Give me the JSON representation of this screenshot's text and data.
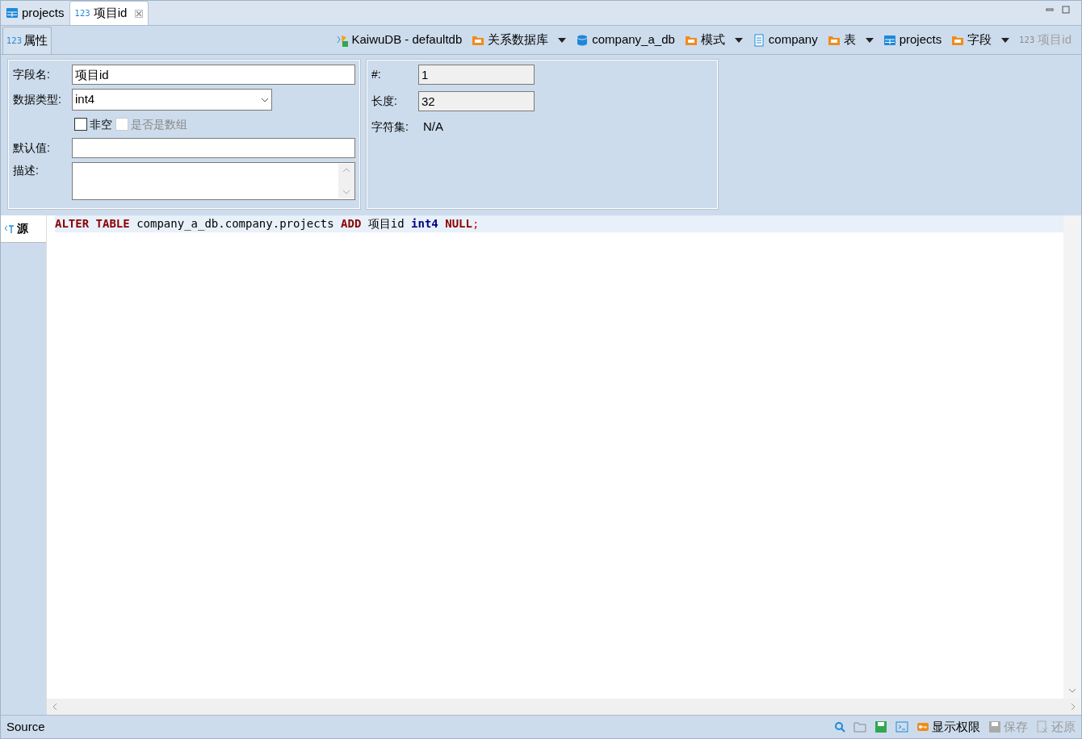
{
  "editor_tabs": [
    {
      "label": "projects",
      "kind": "table",
      "selected": false,
      "closable": false
    },
    {
      "label": "项目id",
      "kind": "column",
      "icon_text": "123",
      "selected": true,
      "closable": true
    }
  ],
  "section_tab": {
    "label": "属性",
    "icon_text": "123",
    "selected": true
  },
  "breadcrumb": [
    {
      "label": "KaiwuDB - defaultdb",
      "kind": "connection",
      "has_menu": false,
      "disabled": false
    },
    {
      "label": "关系数据库",
      "kind": "folder",
      "has_menu": true,
      "disabled": false
    },
    {
      "label": "company_a_db",
      "kind": "database",
      "has_menu": false,
      "disabled": false
    },
    {
      "label": "模式",
      "kind": "folder",
      "has_menu": true,
      "disabled": false
    },
    {
      "label": "company",
      "kind": "schema",
      "has_menu": false,
      "disabled": false
    },
    {
      "label": "表",
      "kind": "folder",
      "has_menu": true,
      "disabled": false
    },
    {
      "label": "projects",
      "kind": "table",
      "has_menu": false,
      "disabled": false
    },
    {
      "label": "字段",
      "kind": "folder",
      "has_menu": true,
      "disabled": false
    },
    {
      "label": "项目id",
      "kind": "column",
      "icon_text": "123",
      "has_menu": false,
      "disabled": true
    }
  ],
  "form": {
    "name_label": "字段名:",
    "name_value": "项目id",
    "type_label": "数据类型:",
    "type_value": "int4",
    "checkboxes": [
      {
        "label": "非空",
        "checked": false,
        "disabled": false
      },
      {
        "label": "是否是数组",
        "checked": false,
        "disabled": true
      }
    ],
    "default_label": "默认值:",
    "description_label": "描述:"
  },
  "info": [
    {
      "label": "#:",
      "value": "1",
      "kind": "field"
    },
    {
      "label": "长度:",
      "value": "32",
      "kind": "field"
    },
    {
      "label": "字符集:",
      "value": "N/A",
      "kind": "text"
    }
  ],
  "source_tab": {
    "label": "源",
    "selected": true
  },
  "sql_tokens": [
    {
      "text": "ALTER TABLE",
      "kind": "keyword"
    },
    {
      "text": "company_a_db.company.projects",
      "kind": "plain"
    },
    {
      "text": "ADD",
      "kind": "keyword"
    },
    {
      "text": "项目id",
      "kind": "plain"
    },
    {
      "text": "int4",
      "kind": "type"
    },
    {
      "text": "NULL",
      "kind": "keyword"
    },
    {
      "text": ";",
      "kind": "punct"
    }
  ],
  "status_bar": {
    "label": "Source",
    "buttons": [
      {
        "label": "显示权限",
        "disabled": false
      },
      {
        "label": "保存",
        "disabled": true
      },
      {
        "label": "还原",
        "disabled": true
      }
    ]
  }
}
